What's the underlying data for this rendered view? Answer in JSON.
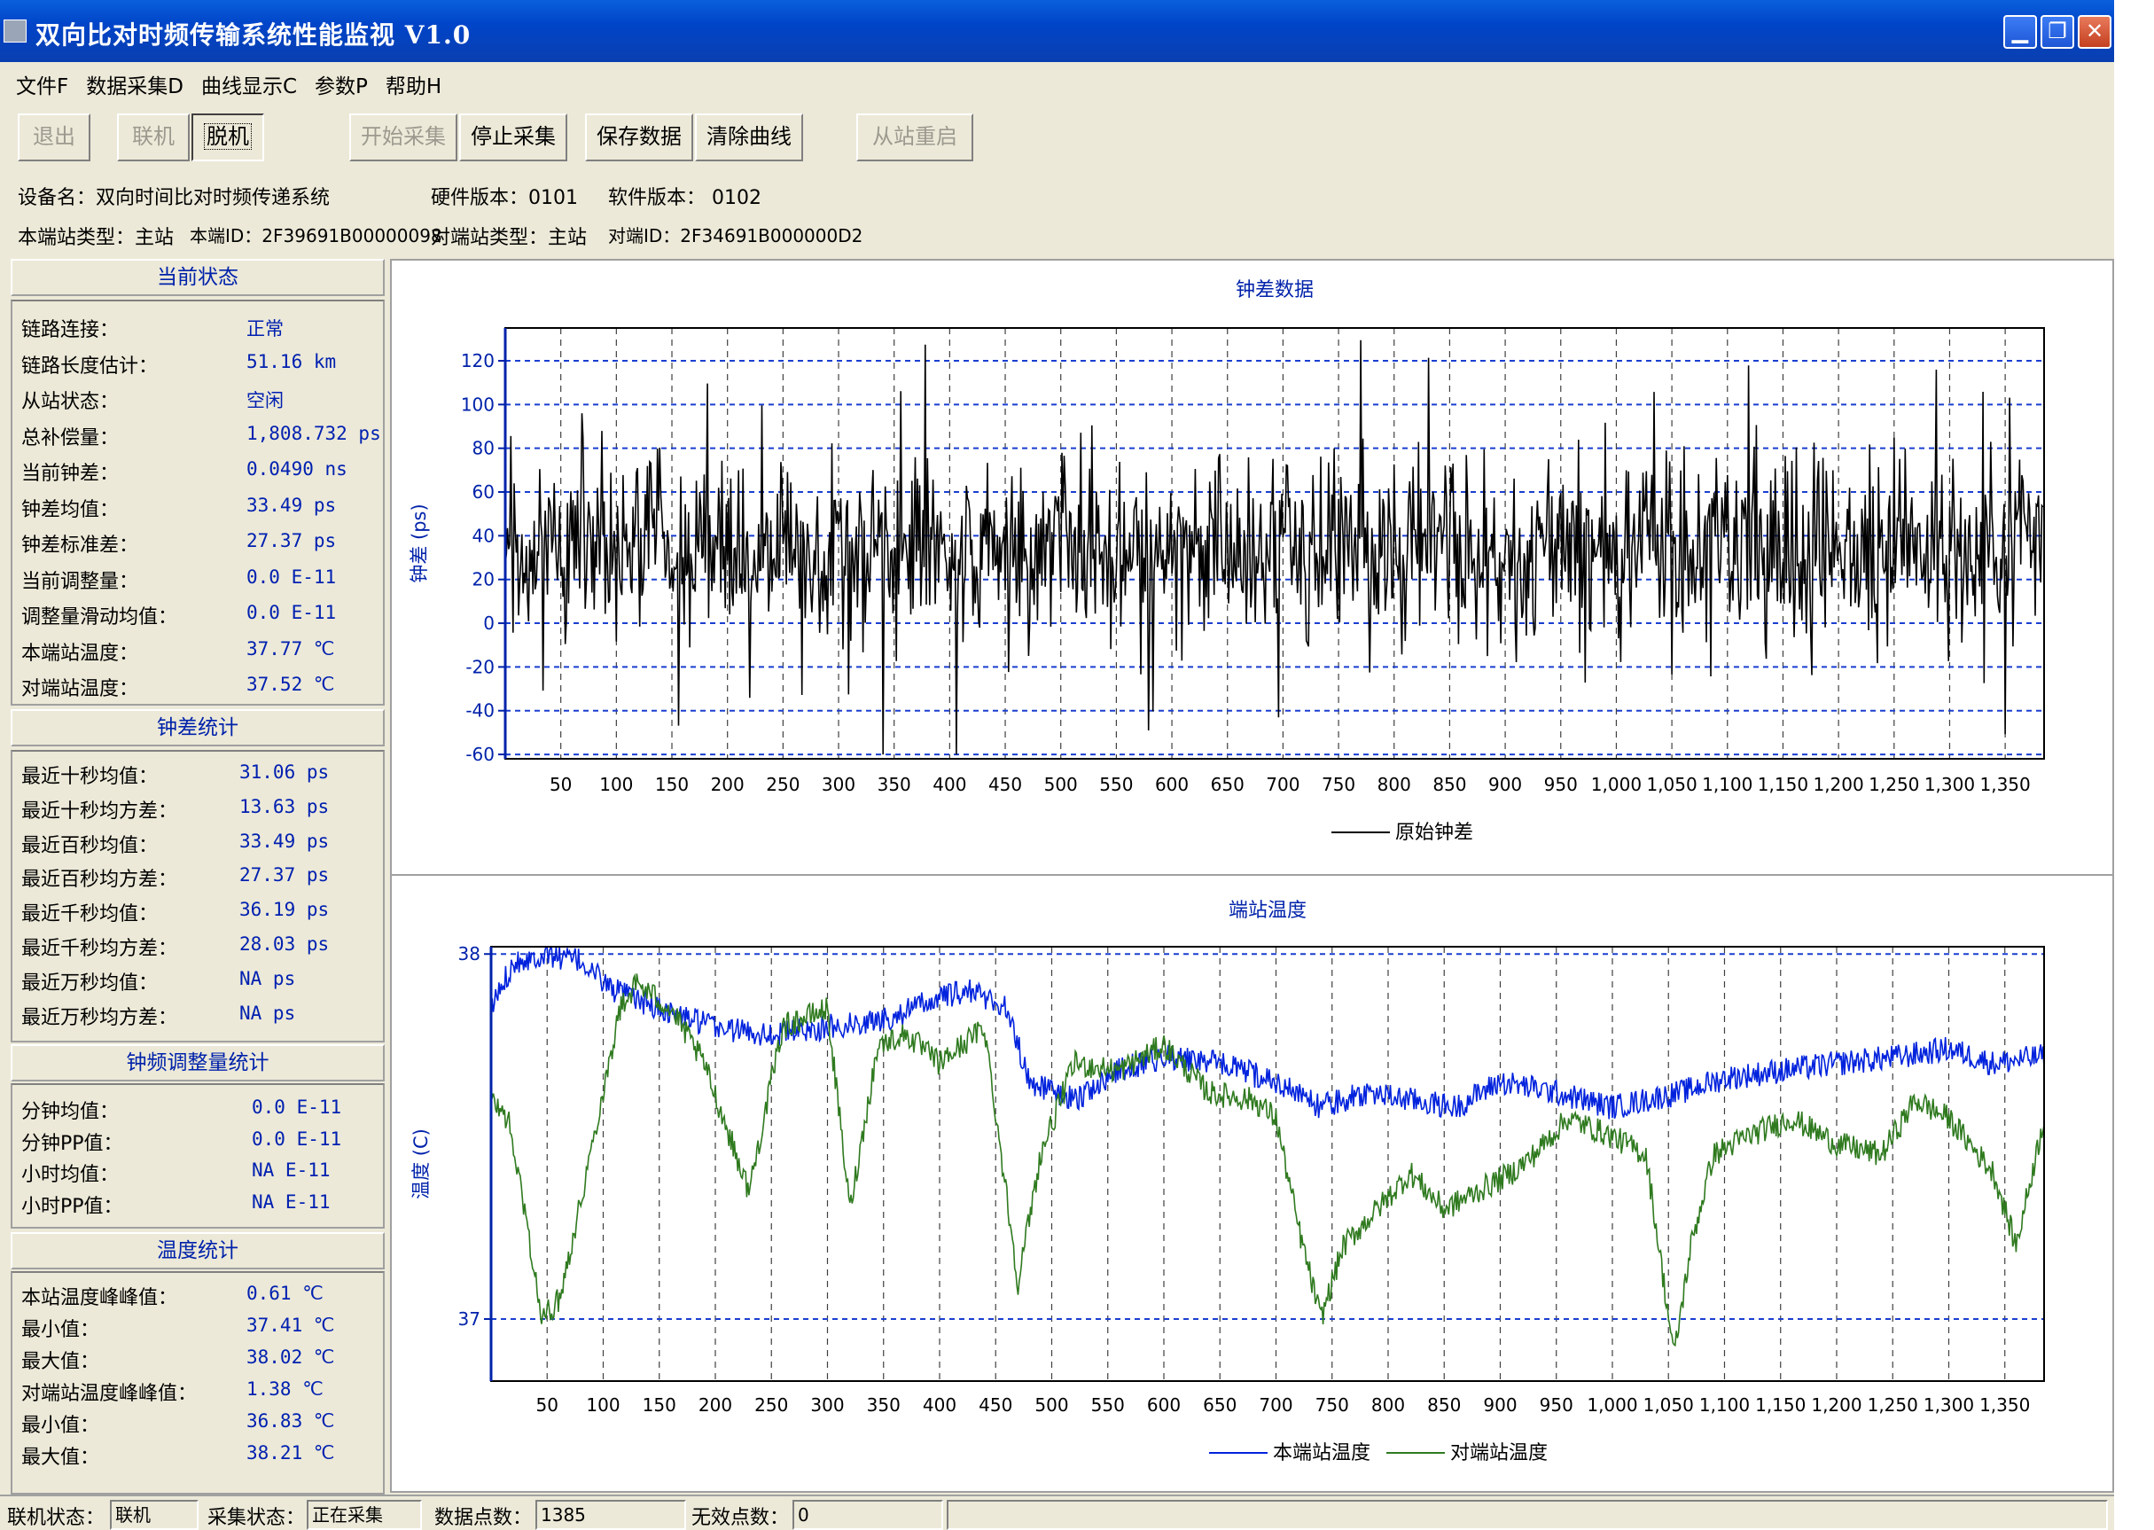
{
  "window": {
    "title": "双向比对时频传输系统性能监视 V1.0"
  },
  "menu": [
    "文件F",
    "数据采集D",
    "曲线显示C",
    "参数P",
    "帮助H"
  ],
  "toolbar": {
    "exit": "退出",
    "connect": "联机",
    "disconnect": "脱机",
    "start": "开始采集",
    "stop": "停止采集",
    "save": "保存数据",
    "clear": "清除曲线",
    "restart": "从站重启"
  },
  "info": {
    "device_name": "设备名：双向时间比对时频传递系统",
    "hw_version": "硬件版本：0101",
    "sw_version": "软件版本： 0102",
    "local_type": "本端站类型：主站",
    "local_id": "本端ID：2F39691B00000098",
    "remote_type": "对端站类型：主站",
    "remote_id": "对端ID：2F34691B000000D2"
  },
  "current_status": {
    "title": "当前状态",
    "rows": [
      {
        "label": "链路连接：",
        "value": "正常"
      },
      {
        "label": "链路长度估计：",
        "value": "51.16 km"
      },
      {
        "label": "从站状态：",
        "value": "空闲"
      },
      {
        "label": "总补偿量：",
        "value": "1,808.732 ps"
      },
      {
        "label": "当前钟差：",
        "value": "0.0490 ns"
      },
      {
        "label": "钟差均值：",
        "value": "33.49 ps"
      },
      {
        "label": "钟差标准差：",
        "value": "27.37 ps"
      },
      {
        "label": "当前调整量：",
        "value": "0.0 E-11"
      },
      {
        "label": "调整量滑动均值：",
        "value": "0.0 E-11"
      },
      {
        "label": "本端站温度：",
        "value": "37.77 ℃"
      },
      {
        "label": "对端站温度：",
        "value": "37.52 ℃"
      }
    ]
  },
  "clock_stats": {
    "title": "钟差统计",
    "rows": [
      {
        "label": "最近十秒均值：",
        "value": "31.06 ps"
      },
      {
        "label": "最近十秒均方差：",
        "value": "13.63 ps"
      },
      {
        "label": "最近百秒均值：",
        "value": "33.49 ps"
      },
      {
        "label": "最近百秒均方差：",
        "value": "27.37 ps"
      },
      {
        "label": "最近千秒均值：",
        "value": "36.19 ps"
      },
      {
        "label": "最近千秒均方差：",
        "value": "28.03 ps"
      },
      {
        "label": "最近万秒均值：",
        "value": "NA ps"
      },
      {
        "label": "最近万秒均方差：",
        "value": "NA ps"
      }
    ]
  },
  "adjust_stats": {
    "title": "钟频调整量统计",
    "rows": [
      {
        "label": "分钟均值：",
        "value": "0.0 E-11"
      },
      {
        "label": "分钟PP值：",
        "value": "0.0 E-11"
      },
      {
        "label": "小时均值：",
        "value": "NA E-11"
      },
      {
        "label": "小时PP值：",
        "value": "NA E-11"
      }
    ]
  },
  "temp_stats": {
    "title": "温度统计",
    "rows": [
      {
        "label": "本站温度峰峰值：",
        "value": "0.61 ℃"
      },
      {
        "label": "最小值：",
        "value": "37.41 ℃"
      },
      {
        "label": "最大值：",
        "value": "38.02 ℃"
      },
      {
        "label": "对端站温度峰峰值：",
        "value": "1.38 ℃"
      },
      {
        "label": "最小值：",
        "value": "36.83 ℃"
      },
      {
        "label": "最大值：",
        "value": "38.21 ℃"
      }
    ]
  },
  "statusbar": {
    "conn_label": "联机状态：",
    "conn_value": "联机",
    "acq_label": "采集状态：",
    "acq_value": "正在采集",
    "points_label": "数据点数：",
    "points_value": "1385",
    "invalid_label": "无效点数：",
    "invalid_value": "0"
  },
  "colors": {
    "chart_series_black": "#000000",
    "local_temp": "#0022dd",
    "remote_temp": "#2f7a1f",
    "grid": "#1a3fd0"
  },
  "chart_data": [
    {
      "type": "line",
      "title": "钟差数据",
      "ylabel": "钟差 (ps)",
      "xlim": [
        0,
        1385
      ],
      "ylim": [
        -62,
        135
      ],
      "xticks": [
        50,
        100,
        150,
        200,
        250,
        300,
        350,
        400,
        450,
        500,
        550,
        600,
        650,
        700,
        750,
        800,
        850,
        900,
        950,
        1000,
        1050,
        1100,
        1150,
        1200,
        1250,
        1300,
        1350
      ],
      "xtick_labels": [
        "50",
        "100",
        "150",
        "200",
        "250",
        "300",
        "350",
        "400",
        "450",
        "500",
        "550",
        "600",
        "650",
        "700",
        "750",
        "800",
        "850",
        "900",
        "950",
        "1,000",
        "1,050",
        "1,100",
        "1,150",
        "1,200",
        "1,250",
        "1,300",
        "1,350"
      ],
      "yticks": [
        -60,
        -40,
        -20,
        0,
        20,
        40,
        60,
        80,
        100,
        120
      ],
      "grid": true,
      "legend": "bottom",
      "series": [
        {
          "name": "原始钟差",
          "color": "#000000",
          "mean": 33.49,
          "std": 27.37,
          "n": 1385,
          "seed": 7,
          "min": -60,
          "max": 134
        }
      ]
    },
    {
      "type": "line",
      "title": "端站温度",
      "ylabel": "温度 (C)",
      "xlim": [
        0,
        1385
      ],
      "ylim": [
        36.83,
        38.02
      ],
      "xticks": [
        50,
        100,
        150,
        200,
        250,
        300,
        350,
        400,
        450,
        500,
        550,
        600,
        650,
        700,
        750,
        800,
        850,
        900,
        950,
        1000,
        1050,
        1100,
        1150,
        1200,
        1250,
        1300,
        1350
      ],
      "xtick_labels": [
        "50",
        "100",
        "150",
        "200",
        "250",
        "300",
        "350",
        "400",
        "450",
        "500",
        "550",
        "600",
        "650",
        "700",
        "750",
        "800",
        "850",
        "900",
        "950",
        "1,000",
        "1,050",
        "1,100",
        "1,150",
        "1,200",
        "1,250",
        "1,300",
        "1,350"
      ],
      "yticks": [
        37,
        38
      ],
      "grid": true,
      "legend": "bottom",
      "series": [
        {
          "name": "本端站温度",
          "color": "#0022dd",
          "anchors": [
            [
              0,
              37.85
            ],
            [
              20,
              37.98
            ],
            [
              50,
              38.0
            ],
            [
              80,
              37.98
            ],
            [
              110,
              37.9
            ],
            [
              150,
              37.85
            ],
            [
              200,
              37.8
            ],
            [
              250,
              37.78
            ],
            [
              300,
              37.8
            ],
            [
              350,
              37.82
            ],
            [
              400,
              37.88
            ],
            [
              430,
              37.9
            ],
            [
              460,
              37.85
            ],
            [
              480,
              37.65
            ],
            [
              520,
              37.6
            ],
            [
              560,
              37.68
            ],
            [
              600,
              37.72
            ],
            [
              650,
              37.7
            ],
            [
              700,
              37.65
            ],
            [
              740,
              37.58
            ],
            [
              780,
              37.62
            ],
            [
              820,
              37.6
            ],
            [
              860,
              37.58
            ],
            [
              900,
              37.65
            ],
            [
              950,
              37.62
            ],
            [
              1000,
              37.58
            ],
            [
              1060,
              37.62
            ],
            [
              1100,
              37.66
            ],
            [
              1150,
              37.68
            ],
            [
              1200,
              37.7
            ],
            [
              1260,
              37.72
            ],
            [
              1300,
              37.74
            ],
            [
              1340,
              37.7
            ],
            [
              1385,
              37.72
            ]
          ]
        },
        {
          "name": "对端站温度",
          "color": "#2f7a1f",
          "anchors": [
            [
              0,
              37.6
            ],
            [
              15,
              37.55
            ],
            [
              30,
              37.3
            ],
            [
              45,
              37.0
            ],
            [
              60,
              37.05
            ],
            [
              75,
              37.25
            ],
            [
              95,
              37.55
            ],
            [
              115,
              37.85
            ],
            [
              130,
              37.92
            ],
            [
              160,
              37.85
            ],
            [
              190,
              37.7
            ],
            [
              230,
              37.35
            ],
            [
              260,
              37.8
            ],
            [
              300,
              37.85
            ],
            [
              320,
              37.3
            ],
            [
              345,
              37.75
            ],
            [
              370,
              37.78
            ],
            [
              400,
              37.7
            ],
            [
              440,
              37.8
            ],
            [
              470,
              37.1
            ],
            [
              490,
              37.45
            ],
            [
              520,
              37.7
            ],
            [
              560,
              37.68
            ],
            [
              600,
              37.75
            ],
            [
              640,
              37.62
            ],
            [
              680,
              37.6
            ],
            [
              700,
              37.55
            ],
            [
              720,
              37.25
            ],
            [
              740,
              37.0
            ],
            [
              760,
              37.2
            ],
            [
              790,
              37.3
            ],
            [
              820,
              37.4
            ],
            [
              850,
              37.3
            ],
            [
              880,
              37.35
            ],
            [
              910,
              37.4
            ],
            [
              930,
              37.45
            ],
            [
              960,
              37.55
            ],
            [
              1000,
              37.5
            ],
            [
              1030,
              37.45
            ],
            [
              1055,
              36.9
            ],
            [
              1070,
              37.2
            ],
            [
              1090,
              37.45
            ],
            [
              1120,
              37.5
            ],
            [
              1160,
              37.55
            ],
            [
              1200,
              37.48
            ],
            [
              1240,
              37.45
            ],
            [
              1270,
              37.6
            ],
            [
              1300,
              37.55
            ],
            [
              1340,
              37.4
            ],
            [
              1360,
              37.2
            ],
            [
              1385,
              37.55
            ]
          ]
        }
      ]
    }
  ]
}
